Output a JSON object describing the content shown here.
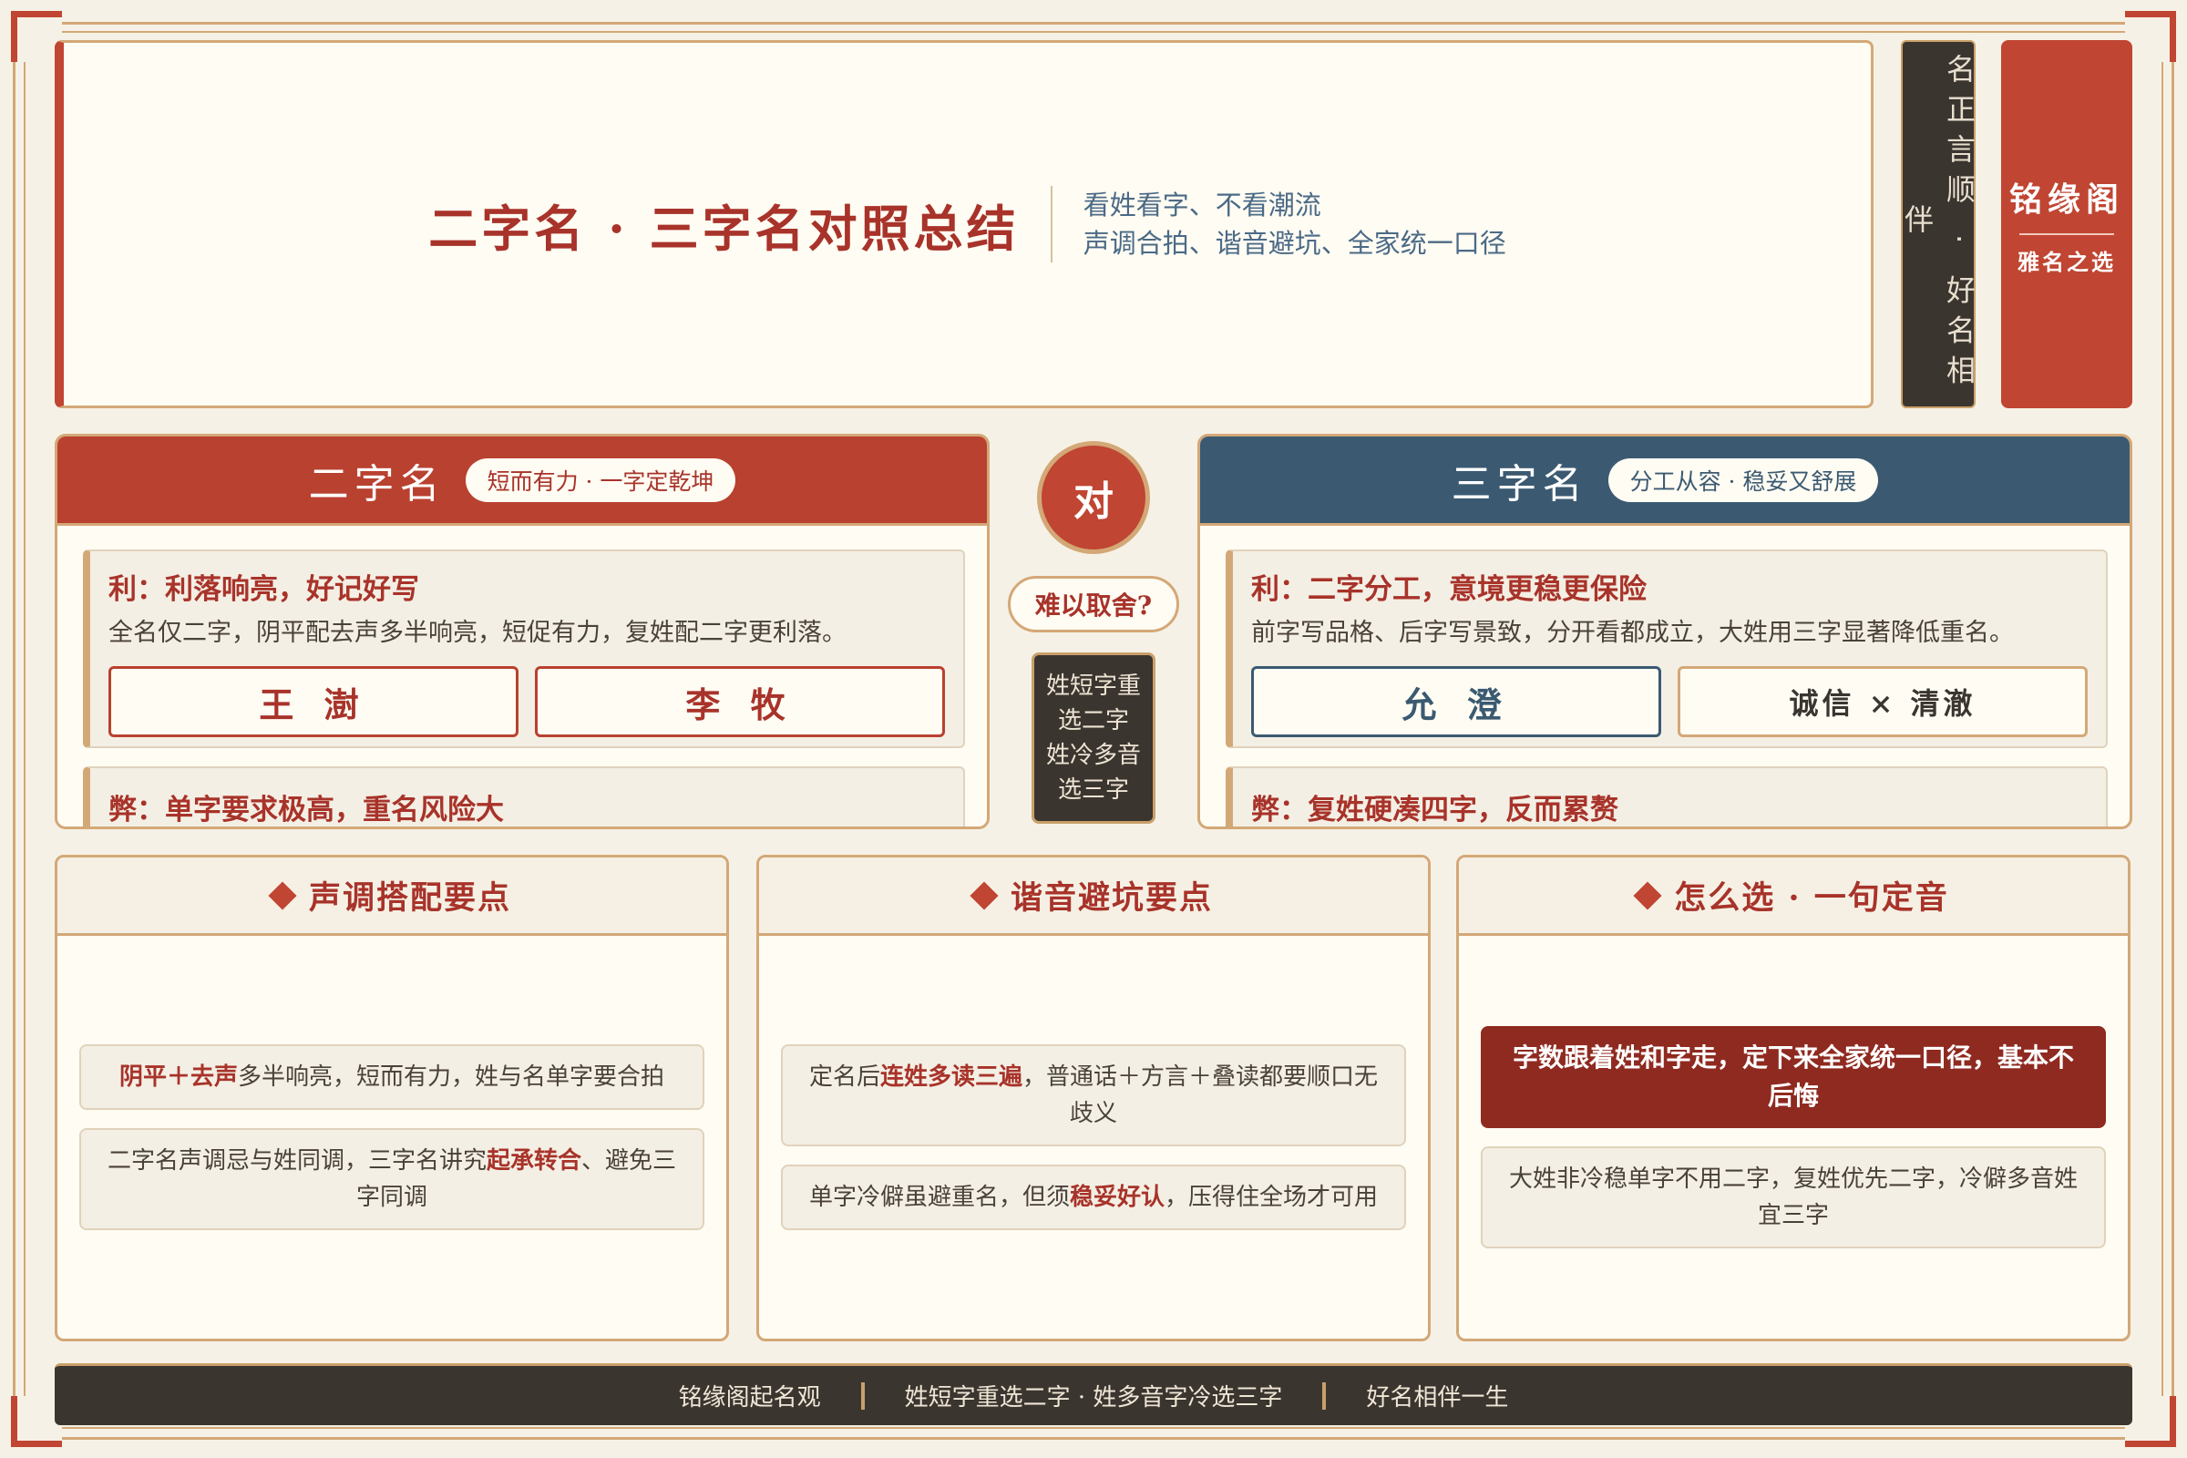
{
  "header": {
    "title": "二字名 · 三字名对照总结",
    "subtitle_line1": "看姓看字、不看潮流",
    "subtitle_line2": "声调合拍、谐音避坑、全家统一口径"
  },
  "side": {
    "motto": "名正言顺 · 好名相伴",
    "brand_name": "铭缘阁",
    "brand_sub": "雅名之选"
  },
  "two_char": {
    "title": "二字名",
    "tag": "短而有力 · 一字定乾坤",
    "pro_title": "利：利落响亮，好记好写",
    "pro_text": "全名仅二字，阴平配去声多半响亮，短促有力，复姓配二字更利落。",
    "example1": "王 澍",
    "example2": "李 牧",
    "con_title": "弊：单字要求极高，重名风险大"
  },
  "three_char": {
    "title": "三字名",
    "tag": "分工从容 · 稳妥又舒展",
    "pro_title": "利：二字分工，意境更稳更保险",
    "pro_text": "前字写品格、后字写景致，分开看都成立，大姓用三字显著降低重名。",
    "example1": "允 澄",
    "example2": "诚信 × 清澈",
    "con_title": "弊：复姓硬凑四字，反而累赘"
  },
  "middle": {
    "vs": "对",
    "question": "难以取舍?",
    "note_line1": "姓短字重",
    "note_line2": "选二字",
    "note_line3": "姓冷多音",
    "note_line4": "选三字"
  },
  "panels": {
    "tone": {
      "title": "声调搭配要点",
      "tip1_hl": "阴平＋去声",
      "tip1_rest": "多半响亮，短而有力，姓与名单字要合拍",
      "tip2_pre": "二字名声调忌与姓同调，三字名讲究",
      "tip2_hl": "起承转合",
      "tip2_post": "、避免三字同调"
    },
    "homophone": {
      "title": "谐音避坑要点",
      "tip1_pre": "定名后",
      "tip1_hl": "连姓多读三遍",
      "tip1_post": "，普通话＋方言＋叠读都要顺口无歧义",
      "tip2_pre": "单字冷僻虽避重名，但须",
      "tip2_hl": "稳妥好认",
      "tip2_post": "，压得住全场才可用"
    },
    "choose": {
      "title": "怎么选 · 一句定音",
      "verdict": "字数跟着姓和字走，定下来全家统一口径，基本不后悔",
      "tip": "大姓非冷稳单字不用二字，复姓优先二字，冷僻多音姓宜三字"
    }
  },
  "footer": {
    "item1": "铭缘阁起名观",
    "item2": "姓短字重选二字 · 姓多音字冷选三字",
    "item3": "好名相伴一生"
  },
  "colors": {
    "accent_red": "#c04532",
    "accent_blue": "#3b5a72",
    "gold": "#d3a877",
    "dark": "#3b3530"
  }
}
